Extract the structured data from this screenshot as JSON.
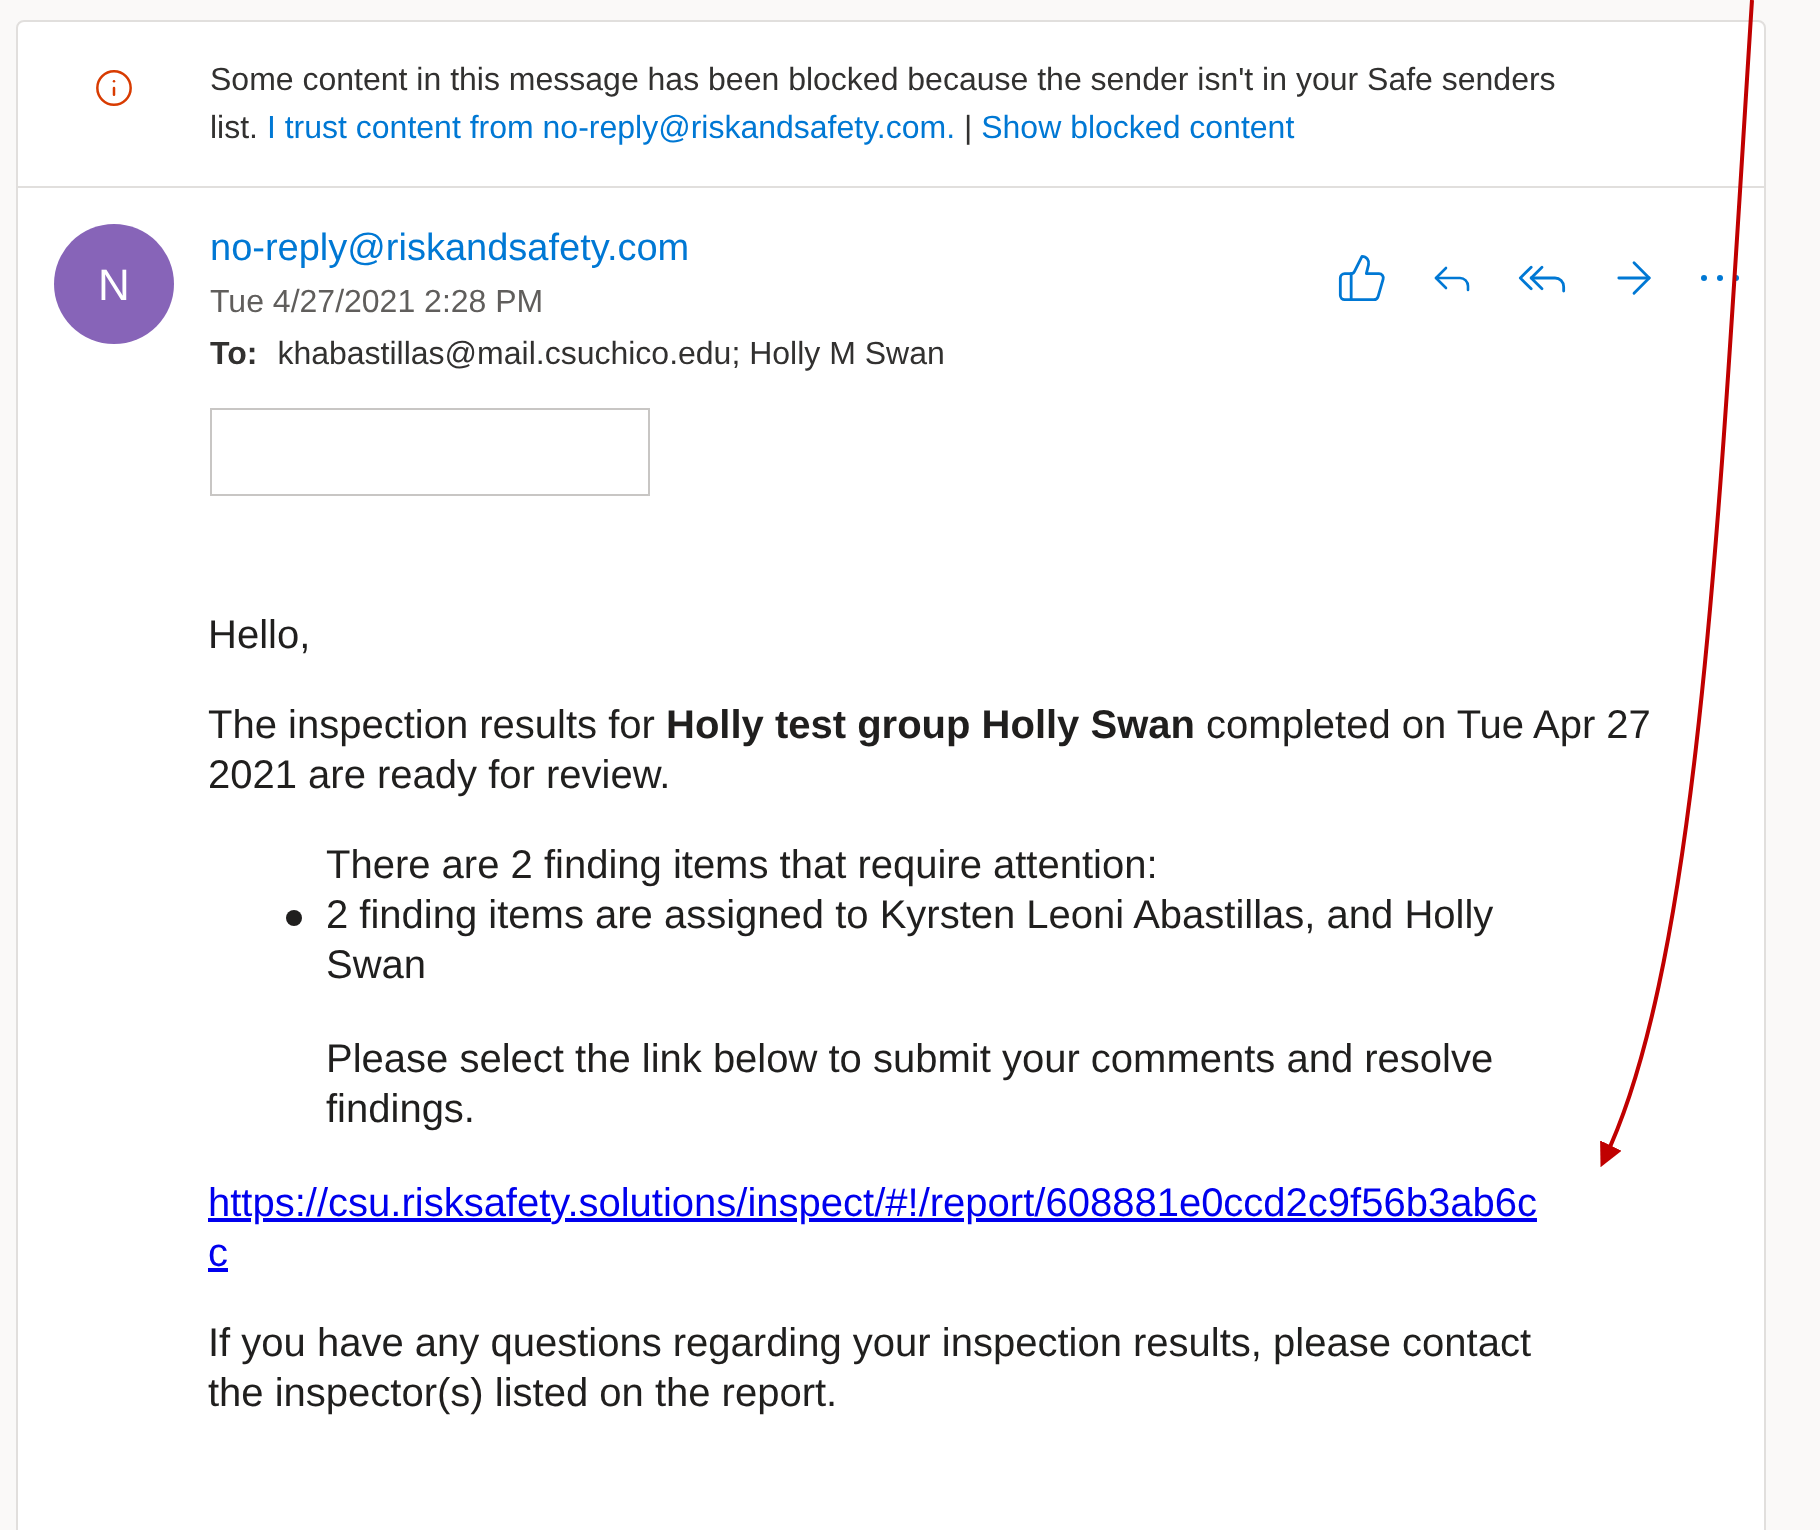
{
  "banner": {
    "message": "Some content in this message has been blocked because the sender isn't in your Safe senders list.",
    "trust_link": "I trust content from no-reply@riskandsafety.com.",
    "separator": "|",
    "show_link": "Show blocked content"
  },
  "header": {
    "avatar": "N",
    "sender": "no-reply@riskandsafety.com",
    "date": "Tue 4/27/2021 2:28 PM",
    "to_label": "To:",
    "recipients": "khabastillas@mail.csuchico.edu; Holly M Swan"
  },
  "body": {
    "greeting": "Hello,",
    "intro": "The inspection results for **Holly test group Holly Swan** completed on Tue Apr 27 2021 are ready for review.",
    "findings_intro": "There are 2 finding items that require attention:",
    "findings": [
      "2 finding items are assigned to Kyrsten Leoni Abastillas, and Holly Swan"
    ],
    "instruction": "Please select the link below to submit your comments and resolve findings.",
    "link": "https://csu.risksafety.solutions/inspect/#!/report/608881e0ccd2c9f56b3ab6cc",
    "closing": "If you have any questions regarding your inspection results, please contact the inspector(s) listed on the report."
  }
}
